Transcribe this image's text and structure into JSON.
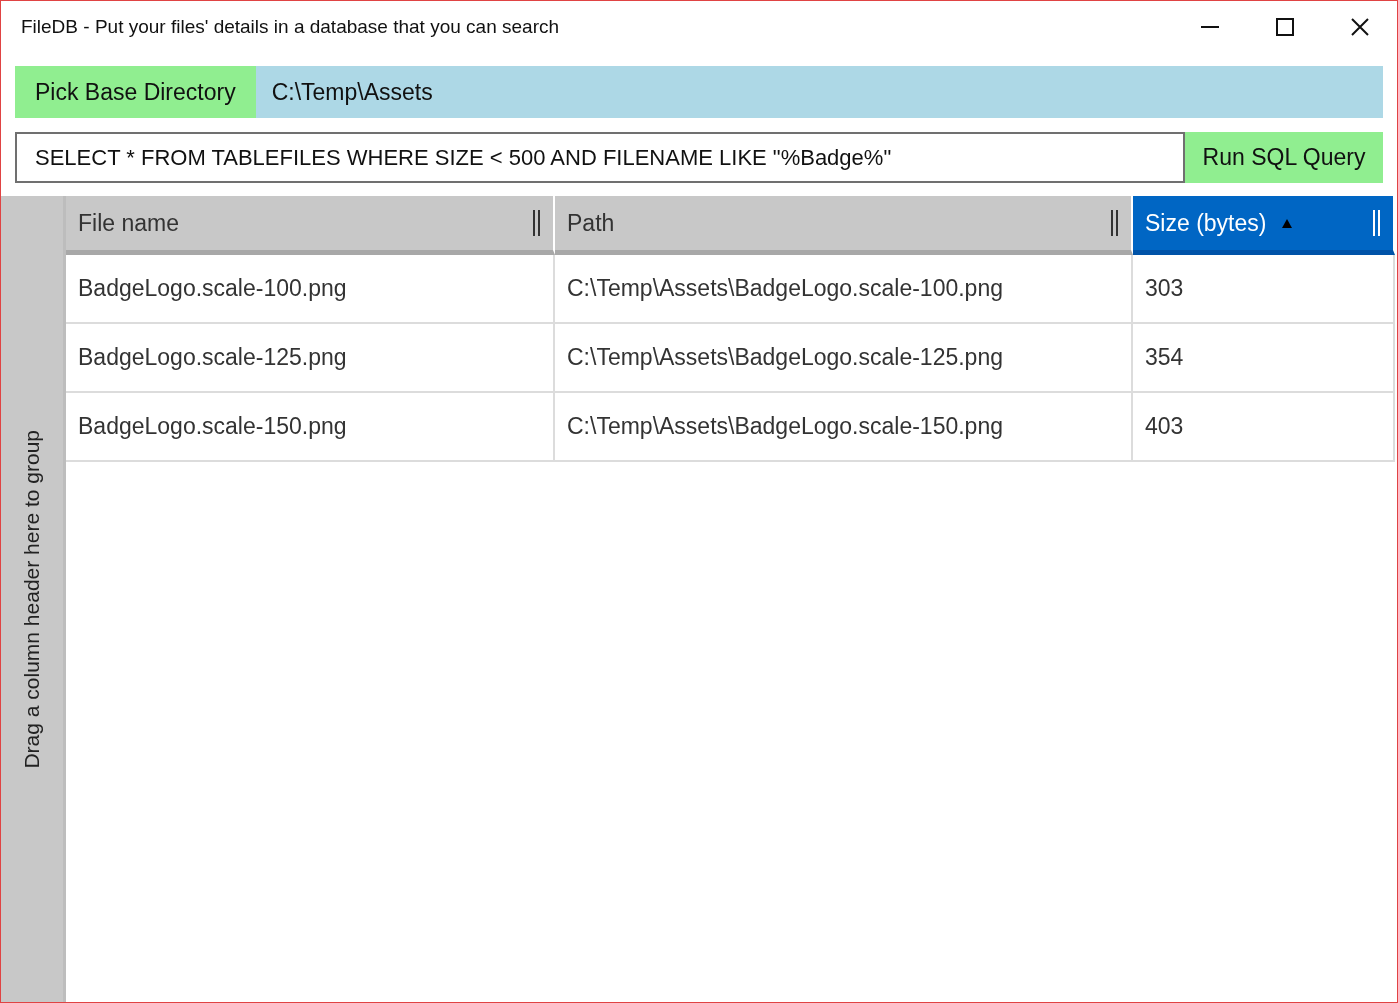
{
  "window": {
    "title": "FileDB - Put your files' details in a database that you can search"
  },
  "directory": {
    "button": "Pick Base Directory",
    "path": "C:\\Temp\\Assets"
  },
  "query": {
    "value": "SELECT * FROM TABLEFILES WHERE SIZE < 500 AND FILENAME LIKE \"%Badge%\"",
    "button": "Run SQL Query"
  },
  "group_panel": {
    "hint": "Drag a column header here to group"
  },
  "table": {
    "columns": [
      {
        "label": "File name",
        "sorted": false
      },
      {
        "label": "Path",
        "sorted": false
      },
      {
        "label": "Size (bytes)",
        "sorted": true
      }
    ],
    "rows": [
      [
        "BadgeLogo.scale-100.png",
        "C:\\Temp\\Assets\\BadgeLogo.scale-100.png",
        "303"
      ],
      [
        "BadgeLogo.scale-125.png",
        "C:\\Temp\\Assets\\BadgeLogo.scale-125.png",
        "354"
      ],
      [
        "BadgeLogo.scale-150.png",
        "C:\\Temp\\Assets\\BadgeLogo.scale-150.png",
        "403"
      ]
    ]
  }
}
